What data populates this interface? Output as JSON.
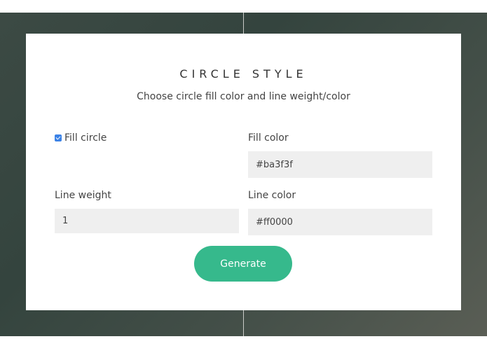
{
  "header": {
    "title": "CIRCLE STYLE",
    "subtitle": "Choose circle fill color and line weight/color"
  },
  "form": {
    "fill_circle": {
      "label": "Fill circle",
      "checked": true
    },
    "fill_color": {
      "label": "Fill color",
      "value": "#ba3f3f"
    },
    "line_weight": {
      "label": "Line weight",
      "value": "1"
    },
    "line_color": {
      "label": "Line color",
      "value": "#ff0000"
    },
    "generate_label": "Generate"
  },
  "colors": {
    "accent": "#36b98c",
    "checkbox": "#3b82e6"
  }
}
